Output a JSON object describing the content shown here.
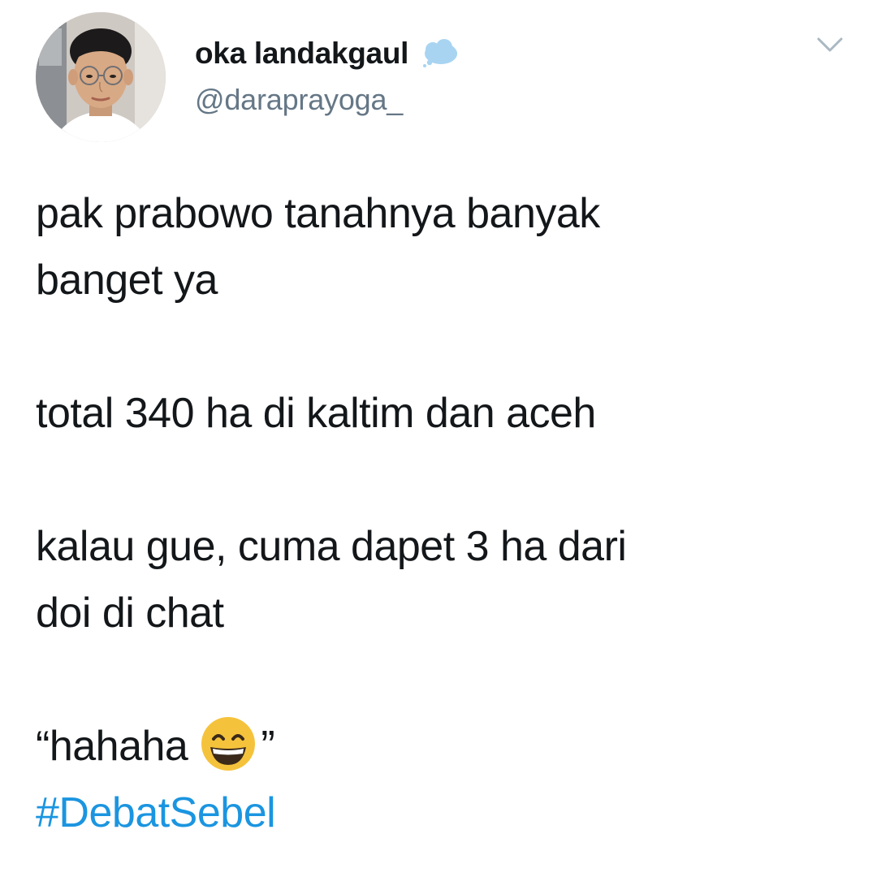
{
  "user": {
    "display_name": "oka landakgaul",
    "handle": "@daraprayoga_",
    "status_icon": "cloud-icon",
    "avatar_icon": "profile-photo"
  },
  "menu": {
    "icon": "chevron-down-icon"
  },
  "tweet": {
    "lines": [
      "pak prabowo tanahnya banyak",
      "banget ya",
      "total 340 ha di kaltim dan aceh",
      "kalau gue, cuma dapet 3 ha dari",
      "doi di chat"
    ],
    "quote_open": "“hahaha",
    "quote_emoji": "grinning-face-smiling-eyes-icon",
    "quote_close": "”",
    "hashtag": "#DebatSebel"
  },
  "colors": {
    "text": "#14171a",
    "secondary": "#657786",
    "link": "#1b95e0",
    "cloud": "#a8d4f2",
    "emoji": "#f5c33b"
  }
}
